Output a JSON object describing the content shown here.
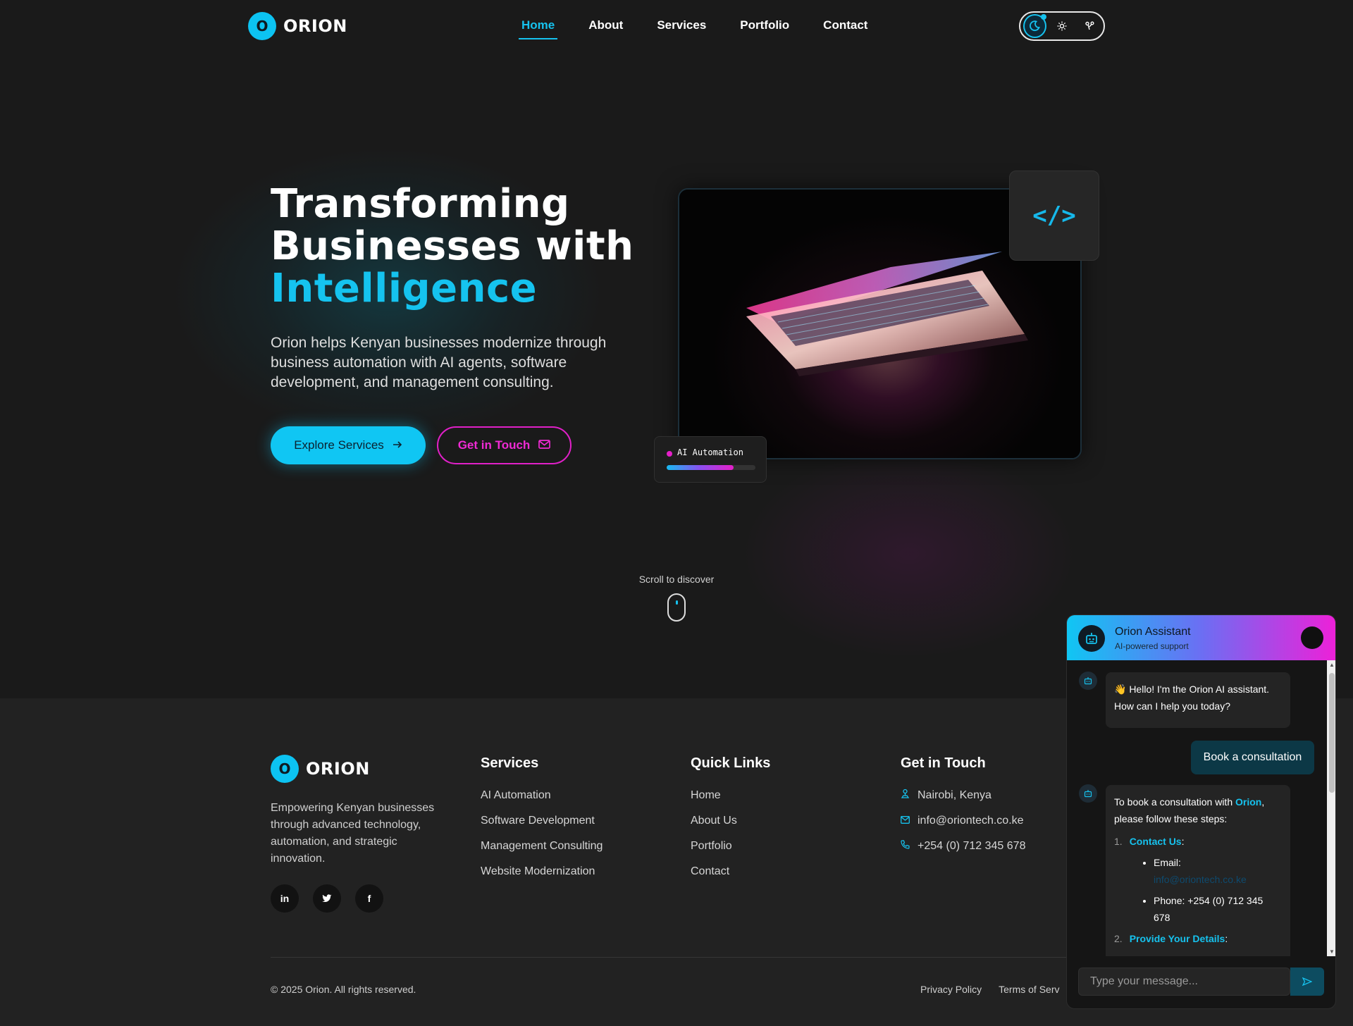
{
  "header": {
    "logo_mark": "O",
    "logo_text": "ORION",
    "nav": [
      "Home",
      "About",
      "Services",
      "Portfolio",
      "Contact"
    ],
    "active_nav": "Home",
    "theme_icons": [
      "moon-icon",
      "sun-icon",
      "palette-icon"
    ]
  },
  "hero": {
    "title_line1": "Transforming",
    "title_line2": "Businesses with",
    "title_accent": "Intelligence",
    "description": "Orion helps Kenyan businesses modernize through business automation with AI agents, software development, and management consulting.",
    "primary_button": "Explore Services",
    "secondary_button": "Get in Touch",
    "code_icon": "</>",
    "automation_label": "AI Automation",
    "automation_progress": 0.75,
    "scroll_label": "Scroll to discover"
  },
  "footer": {
    "logo_mark": "O",
    "logo_text": "ORION",
    "description": "Empowering Kenyan businesses through advanced technology, automation, and strategic innovation.",
    "socials": [
      "in",
      "t",
      "f"
    ],
    "services_title": "Services",
    "services": [
      "AI Automation",
      "Software Development",
      "Management Consulting",
      "Website Modernization"
    ],
    "quick_links_title": "Quick Links",
    "quick_links": [
      "Home",
      "About Us",
      "Portfolio",
      "Contact"
    ],
    "contact_title": "Get in Touch",
    "contact": [
      "Nairobi, Kenya",
      "info@oriontech.co.ke",
      "+254 (0) 712 345 678"
    ],
    "copyright": "© 2025 Orion. All rights reserved.",
    "privacy": "Privacy Policy",
    "terms": "Terms of Serv"
  },
  "chat": {
    "title": "Orion Assistant",
    "subtitle": "AI-powered support",
    "greeting": "👋 Hello! I'm the Orion AI assistant. How can I help you today?",
    "user_message": "Book a consultation",
    "reply_intro_a": "To book a consultation with ",
    "reply_brand": "Orion",
    "reply_intro_b": ", please follow these steps:",
    "step1_title": "Contact Us",
    "email_label": "Email:",
    "email_value": "info@oriontech.co.ke",
    "phone_line": "Phone: +254 (0) 712 345 678",
    "step2_title": "Provide Your Details",
    "input_placeholder": "Type your message..."
  }
}
